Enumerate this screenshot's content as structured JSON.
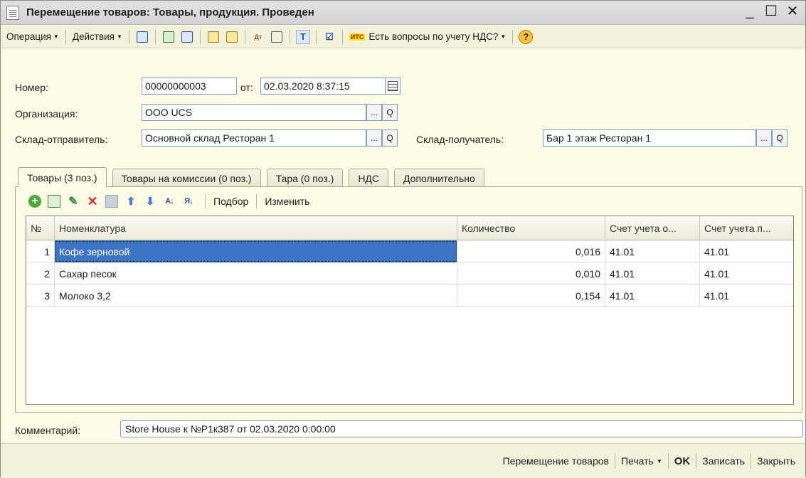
{
  "window": {
    "title": "Перемещение товаров: Товары, продукция. Проведен",
    "controls": {
      "minimize": "_",
      "maximize": "☐",
      "close": "✕"
    }
  },
  "toolbar": {
    "operation_label": "Операция",
    "actions_label": "Действия",
    "its_badge": "ИТС",
    "vat_questions_label": "Есть вопросы по учету НДС?",
    "icons": [
      "post-icon",
      "refresh-icon",
      "copy-doc-icon",
      "based-on-icon",
      "structure-icon",
      "dt-kt-icon",
      "report-icon",
      "textfield-icon",
      "check-icon",
      "help-icon"
    ]
  },
  "form": {
    "number_label": "Номер:",
    "number_value": "00000000003",
    "date_label": "от:",
    "date_value": "02.03.2020  8:37:15",
    "org_label": "Организация:",
    "org_value": "ООО UCS",
    "sender_label": "Склад-отправитель:",
    "sender_value": "Основной склад Ресторан 1",
    "receiver_label": "Склад-получатель:",
    "receiver_value": "Бар 1 этаж Ресторан 1",
    "ellipsis": "...",
    "search_glyph": "Q"
  },
  "tabs": [
    {
      "label": "Товары (3 поз.)",
      "active": true
    },
    {
      "label": "Товары на комиссии (0 поз.)",
      "active": false
    },
    {
      "label": "Тара (0 поз.)",
      "active": false
    },
    {
      "label": "НДС",
      "active": false
    },
    {
      "label": "Дополнительно",
      "active": false
    }
  ],
  "table_toolbar": {
    "select_label": "Подбор",
    "change_label": "Изменить"
  },
  "table": {
    "columns": [
      "№",
      "Номенклатура",
      "Количество",
      "Счет учета о...",
      "Счет учета п..."
    ],
    "rows": [
      {
        "n": "1",
        "name": "Кофе зерновой",
        "qty": "0,016",
        "acc_from": "41.01",
        "acc_to": "41.01",
        "selected": true
      },
      {
        "n": "2",
        "name": "Сахар песок",
        "qty": "0,010",
        "acc_from": "41.01",
        "acc_to": "41.01",
        "selected": false
      },
      {
        "n": "3",
        "name": "Молоко 3,2",
        "qty": "0,154",
        "acc_from": "41.01",
        "acc_to": "41.01",
        "selected": false
      }
    ]
  },
  "comment": {
    "label": "Комментарий:",
    "value": "Store House к №Р1к387 от 02.03.2020 0:00:00"
  },
  "bottom": {
    "move_goods": "Перемещение товаров",
    "print": "Печать",
    "ok": "OK",
    "save": "Записать",
    "close": "Закрыть"
  }
}
